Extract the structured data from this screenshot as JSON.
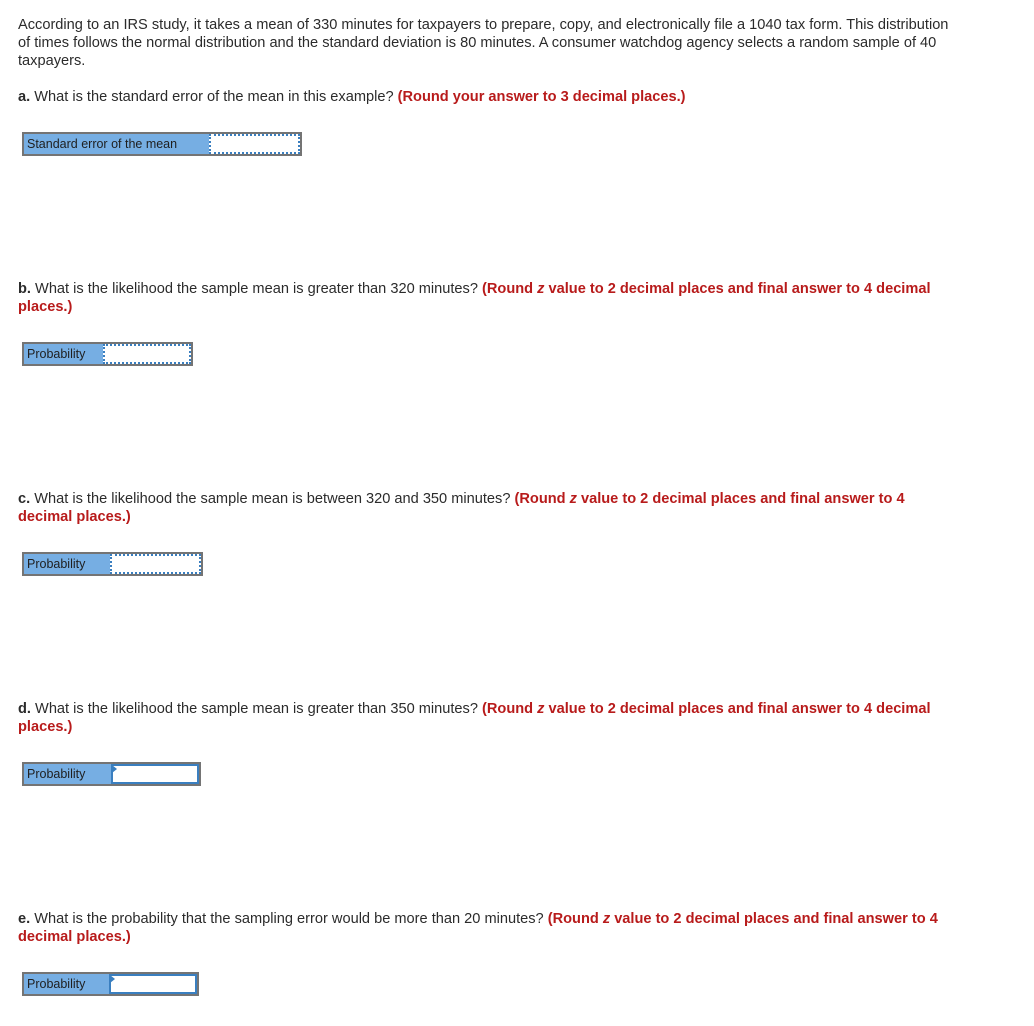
{
  "intro": "According to an IRS study, it takes a mean of 330 minutes for taxpayers to prepare, copy, and electronically file a 1040 tax form. This distribution of times follows the normal distribution and the standard deviation is 80 minutes. A consumer watchdog agency selects a random sample of 40 taxpayers.",
  "questions": [
    {
      "letter": "a.",
      "text": " What is the standard error of the mean in this example? ",
      "instr_pre": "(Round your answer to 3 decimal places.)",
      "instr_z": "",
      "instr_post": "",
      "answer_label": "Standard error of the mean",
      "answer_value": "",
      "answer_placeholder": ""
    },
    {
      "letter": "b.",
      "text": " What is the likelihood the sample mean is greater than 320 minutes? ",
      "instr_pre": "(Round ",
      "instr_z": "z",
      "instr_post": " value to 2 decimal places and final answer to 4 decimal places.)",
      "answer_label": "Probability",
      "answer_value": "",
      "answer_placeholder": ""
    },
    {
      "letter": "c.",
      "text": " What is the likelihood the sample mean is between 320 and 350 minutes? ",
      "instr_pre": "(Round ",
      "instr_z": "z",
      "instr_post": " value to 2 decimal places and final answer to 4 decimal places.)",
      "answer_label": "Probability",
      "answer_value": "",
      "answer_placeholder": ""
    },
    {
      "letter": "d.",
      "text": " What is the likelihood the sample mean is greater than 350 minutes? ",
      "instr_pre": "(Round ",
      "instr_z": "z",
      "instr_post": " value to 2 decimal places and final answer to 4 decimal places.)",
      "answer_label": "Probability",
      "answer_value": "",
      "answer_placeholder": ""
    },
    {
      "letter": "e.",
      "text": " What is the probability that the sampling error would be more than 20 minutes? ",
      "instr_pre": "(Round ",
      "instr_z": "z",
      "instr_post": " value to 2 decimal places and final answer to 4 decimal places.)",
      "answer_label": "Probability",
      "answer_value": "",
      "answer_placeholder": ""
    }
  ],
  "colors": {
    "instruction_red": "#b81b1b",
    "label_blue": "#76aee3",
    "input_border_blue": "#3a7fc0",
    "frame_gray": "#747474"
  }
}
